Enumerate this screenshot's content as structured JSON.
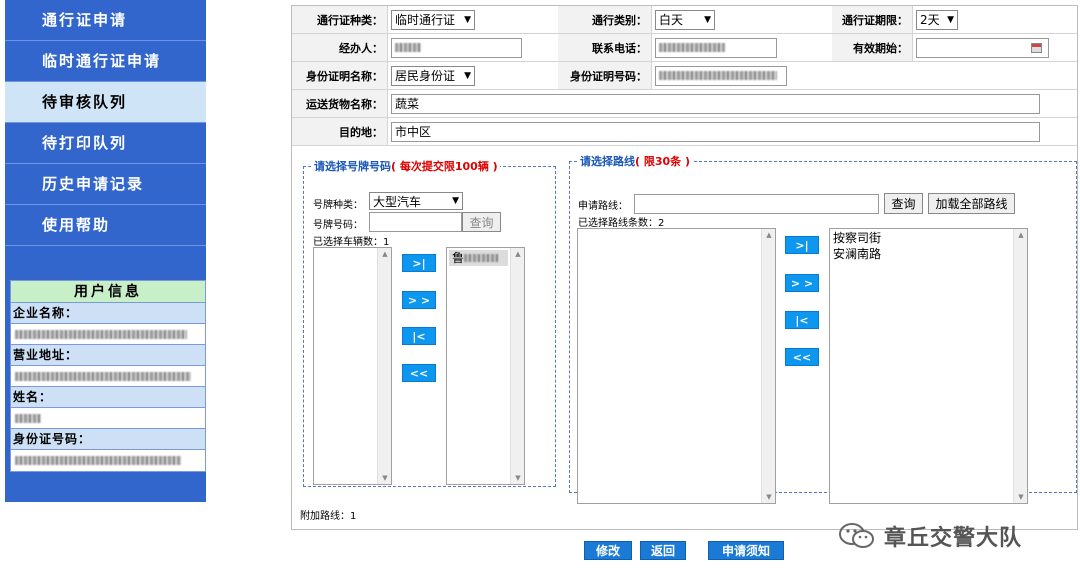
{
  "sidebar": {
    "items": [
      {
        "label": "通行证申请",
        "active": false
      },
      {
        "label": "临时通行证申请",
        "active": false
      },
      {
        "label": "待审核队列",
        "active": true
      },
      {
        "label": "待打印队列",
        "active": false
      },
      {
        "label": "历史申请记录",
        "active": false
      },
      {
        "label": "使用帮助",
        "active": false
      }
    ],
    "user_info": {
      "title": "用户信息",
      "company_label": "企业名称：",
      "address_label": "营业地址：",
      "name_label": "姓名：",
      "id_label": "身份证号码："
    }
  },
  "form": {
    "pass_type_label": "通行证种类：",
    "pass_type_value": "临时通行证",
    "travel_type_label": "通行类别：",
    "travel_type_value": "白天",
    "period_label": "通行证期限：",
    "period_value": "2天",
    "handler_label": "经办人：",
    "phone_label": "联系电话：",
    "valid_start_label": "有效期始：",
    "id_doc_label": "身份证明名称：",
    "id_doc_value": "居民身份证",
    "id_number_label": "身份证明号码：",
    "cargo_label": "运送货物名称：",
    "cargo_value": "蔬菜",
    "destination_label": "目的地：",
    "destination_value": "市中区"
  },
  "plates": {
    "legend": "请选择号牌号码",
    "legend_note": "( 每次提交限100辆 )",
    "plate_type_label": "号牌种类：",
    "plate_type_value": "大型汽车",
    "plate_no_label": "号牌号码：",
    "query_button": "查询",
    "selected_count_label": "已选择车辆数：",
    "selected_count": "1",
    "selected_prefix": "鲁",
    "buttons": [
      ">|",
      "> >",
      "|<",
      "<<"
    ]
  },
  "routes": {
    "legend": "请选择路线",
    "legend_note": "( 限30条 )",
    "apply_label": "申请路线：",
    "query_button": "查询",
    "load_all_button": "加载全部路线",
    "selected_count_label": "已选择路线条数：",
    "selected_count": "2",
    "selected": [
      "按察司街",
      "安澜南路"
    ],
    "buttons": [
      ">|",
      "> >",
      "|<",
      "<<"
    ]
  },
  "extra_route_label": "附加路线：",
  "extra_route_count": "1",
  "actions": {
    "modify": "修改",
    "back": "返回",
    "notice": "申请须知"
  },
  "watermark": "章丘交警大队"
}
